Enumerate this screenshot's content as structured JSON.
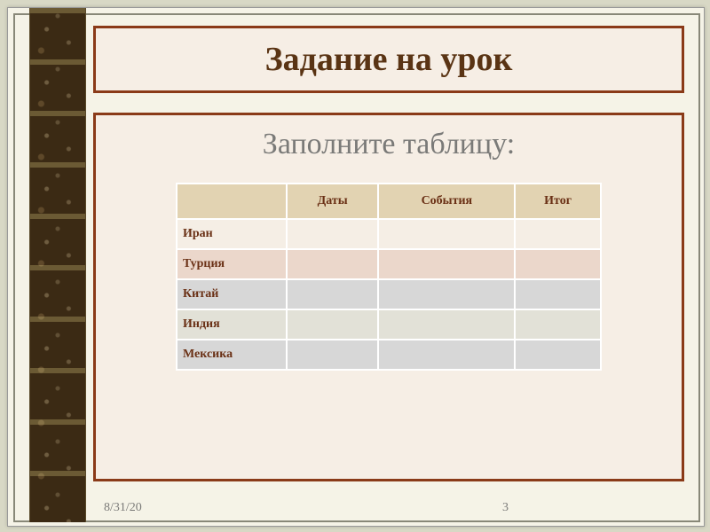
{
  "title": "Задание на урок",
  "subtitle": "Заполните таблицу:",
  "table": {
    "headers": [
      "",
      "Даты",
      "События",
      "Итог"
    ],
    "rows": [
      {
        "label": "Иран",
        "cells": [
          "",
          "",
          ""
        ]
      },
      {
        "label": "Турция",
        "cells": [
          "",
          "",
          ""
        ]
      },
      {
        "label": "Китай",
        "cells": [
          "",
          "",
          ""
        ]
      },
      {
        "label": "Индия",
        "cells": [
          "",
          "",
          ""
        ]
      },
      {
        "label": "Мексика",
        "cells": [
          "",
          "",
          ""
        ]
      }
    ]
  },
  "footer": {
    "date": "8/31/20",
    "page": "3"
  }
}
